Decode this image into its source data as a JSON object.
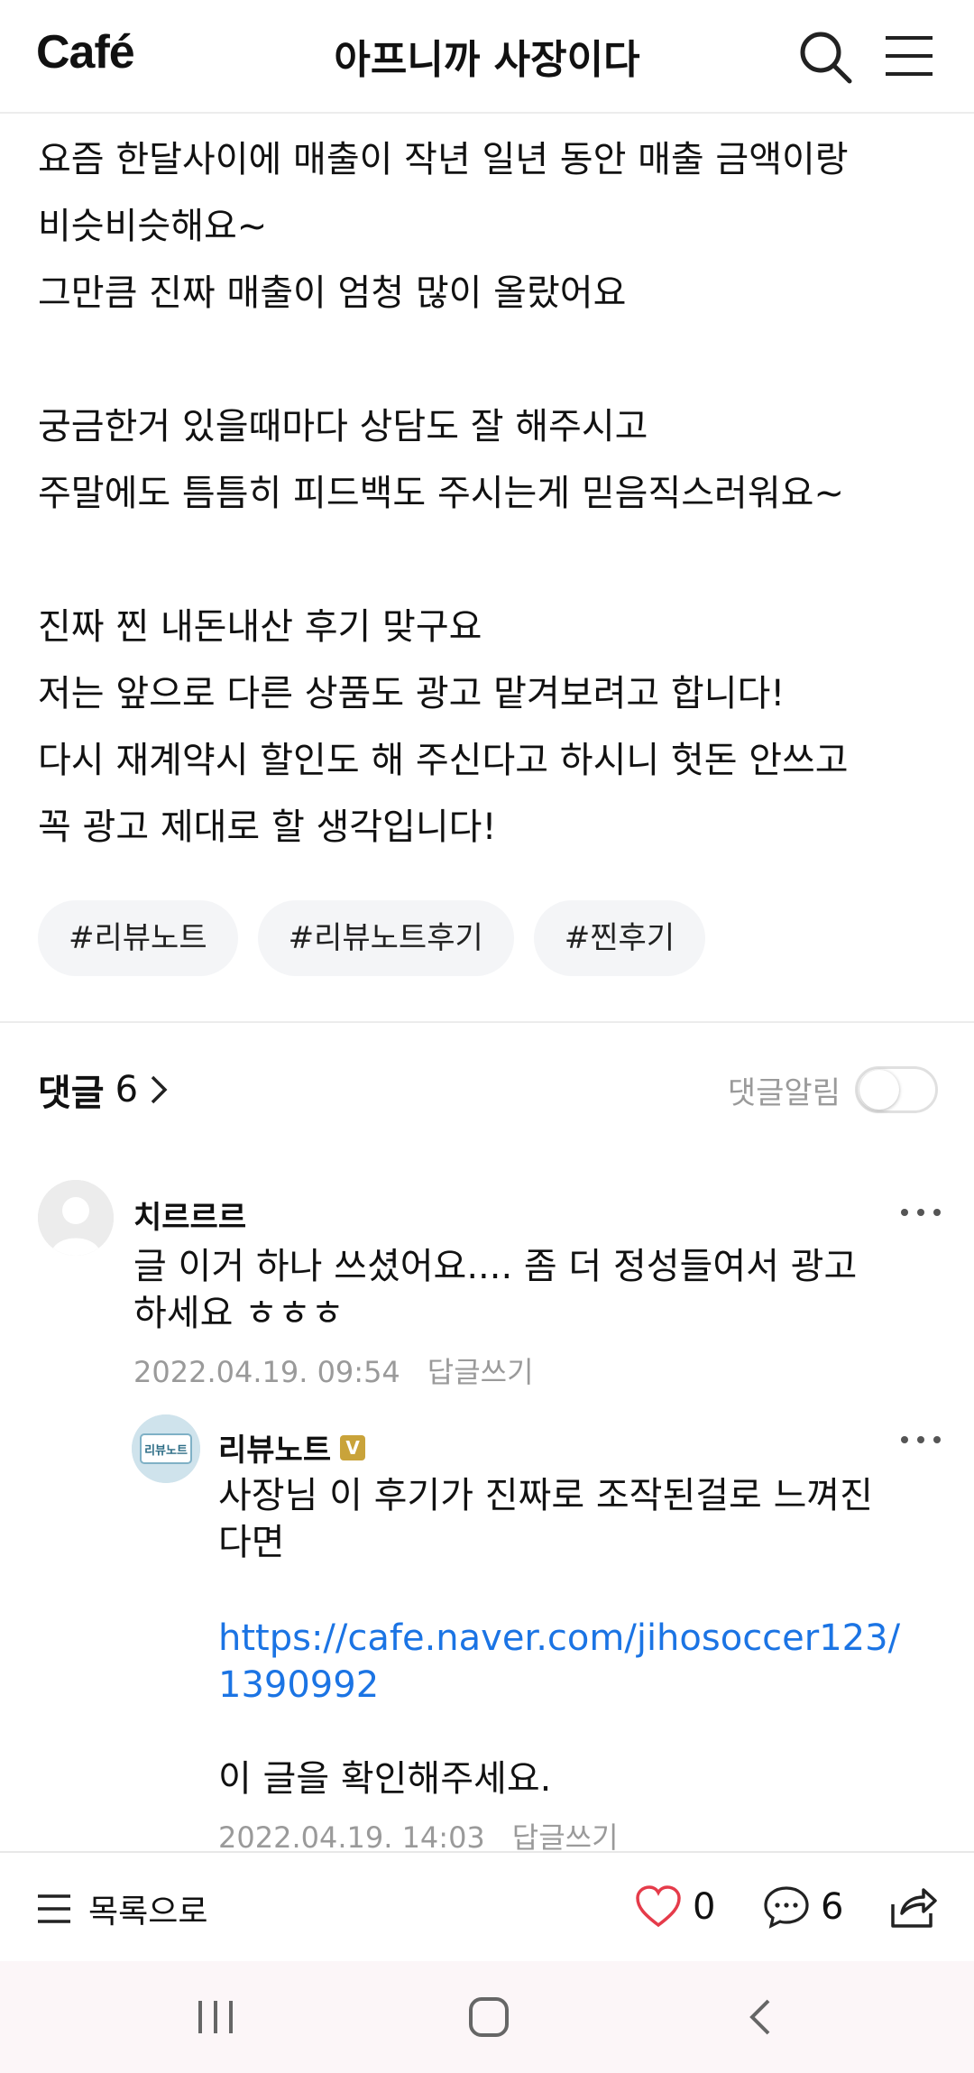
{
  "header": {
    "logo": "Café",
    "title": "아프니까 사장이다"
  },
  "post": {
    "lines": [
      "요즘 한달사이에 매출이 작년 일년 동안 매출 금액이랑",
      "비슷비슷해요~",
      "그만큼 진짜 매출이 엄청 많이 올랐어요",
      "",
      "궁금한거 있을때마다 상담도 잘 해주시고",
      "주말에도 틈틈히 피드백도 주시는게 믿음직스러워요~",
      "",
      "진짜 찐 내돈내산 후기 맞구요",
      "저는 앞으로 다른 상품도 광고 맡겨보려고 합니다!",
      "다시 재계약시 할인도 해 주신다고 하시니 헛돈 안쓰고",
      "꼭 광고 제대로 할 생각입니다!"
    ],
    "tags": [
      "#리뷰노트",
      "#리뷰노트후기",
      "#찐후기"
    ]
  },
  "comments_header": {
    "label": "댓글",
    "count": "6",
    "notify_label": "댓글알림"
  },
  "comments": [
    {
      "author": "치르르르",
      "text_lines": [
        "글 이거 하나 쓰셨어요.... 좀 더 정성들여서 광고",
        "하세요 ㅎㅎㅎ"
      ],
      "date": "2022.04.19. 09:54",
      "reply_label": "답글쓰기"
    },
    {
      "author": "리뷰노트",
      "badge": "V",
      "avatar_text": "리뷰노트",
      "text_lines": [
        "사장님 이 후기가 진짜로 조작된걸로 느껴진",
        "다면"
      ],
      "link_lines": [
        "https://cafe.naver.com/jihosoccer123/",
        "1390992"
      ],
      "closing": "이 글을 확인해주세요.",
      "date": "2022.04.19. 14:03",
      "reply_label": "답글쓰기"
    }
  ],
  "bottom_bar": {
    "list_label": "목록으로",
    "likes": "0",
    "comments": "6"
  },
  "colors": {
    "accent_green": "#1fc75a",
    "link": "#1b74e4",
    "heart": "#e53b4a",
    "badge": "#c9a33a"
  },
  "icons": [
    "search-icon",
    "hamburger-menu-icon",
    "chevron-right-icon",
    "more-icon",
    "heart-icon",
    "comment-icon",
    "share-icon",
    "recent-apps-icon",
    "home-icon",
    "back-icon"
  ]
}
